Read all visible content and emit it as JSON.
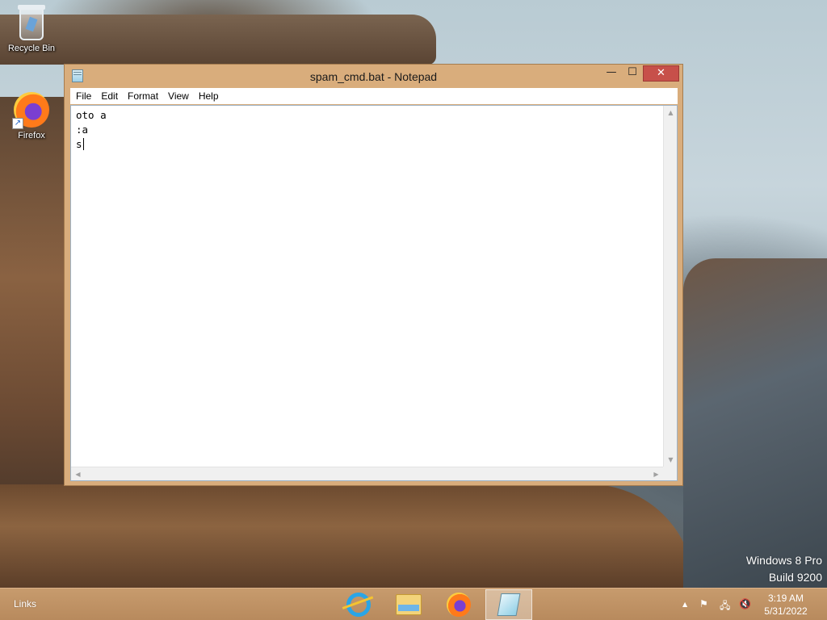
{
  "desktop": {
    "icons": [
      {
        "label": "Recycle Bin",
        "icon": "recycle-bin-icon"
      },
      {
        "label": "Firefox",
        "icon": "firefox-icon"
      }
    ],
    "watermark": {
      "line1": "Windows 8 Pro",
      "line2": "Build 9200"
    }
  },
  "window": {
    "title": "spam_cmd.bat - Notepad",
    "controls": {
      "minimize": "—",
      "maximize": "☐",
      "close": "✕"
    },
    "menu": [
      "File",
      "Edit",
      "Format",
      "View",
      "Help"
    ],
    "content_lines": [
      "oto a",
      ":a",
      "s"
    ]
  },
  "taskbar": {
    "links_label": "Links",
    "pinned": [
      {
        "icon": "internet-explorer-icon"
      },
      {
        "icon": "file-explorer-icon"
      },
      {
        "icon": "firefox-icon"
      },
      {
        "icon": "notepad-icon",
        "active": true
      }
    ],
    "tray": {
      "chevron": "▲",
      "flag": "⚑",
      "network": "🖧",
      "volume": "🔇"
    },
    "clock": {
      "time": "3:19 AM",
      "date": "5/31/2022"
    }
  },
  "colors": {
    "window_frame": "#d9ad7c",
    "close_button": "#c7504a",
    "taskbar": "#c79b6d"
  }
}
